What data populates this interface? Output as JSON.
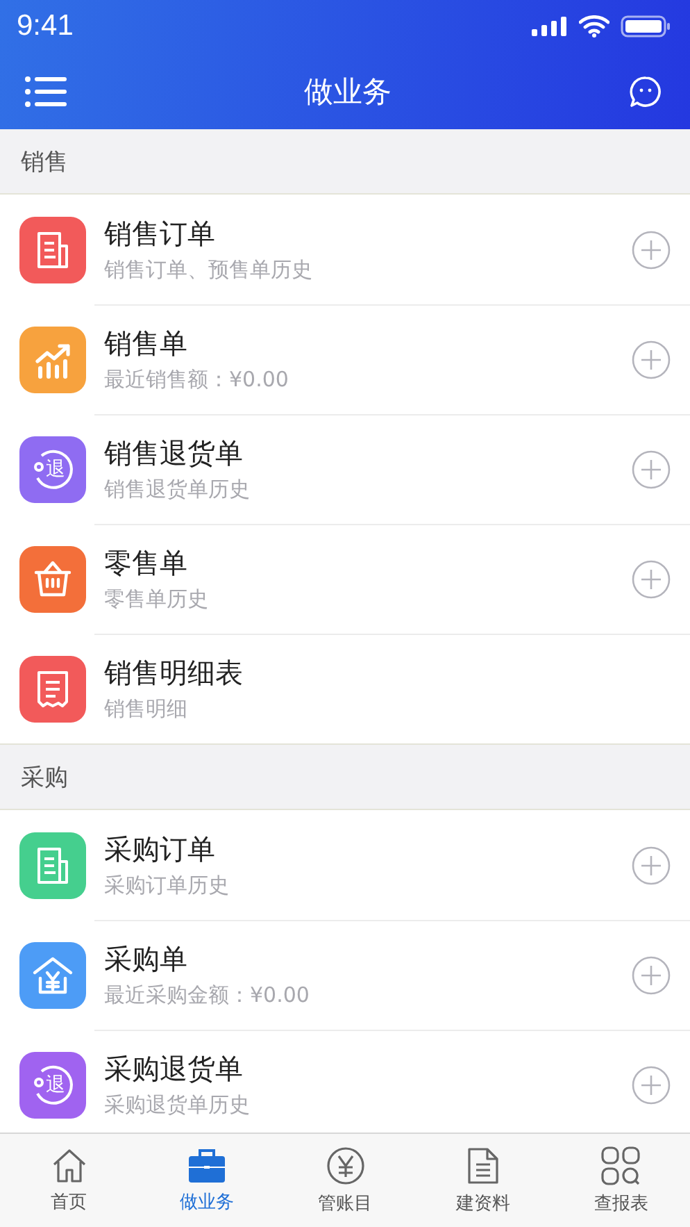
{
  "status_bar": {
    "time": "9:41"
  },
  "nav": {
    "title": "做业务"
  },
  "sections": [
    {
      "title": "销售",
      "items": [
        {
          "title": "销售订单",
          "subtitle": "销售订单、预售单历史",
          "kind": "document",
          "color": "#f25a5a",
          "addable": true
        },
        {
          "title": "销售单",
          "subtitle": "最近销售额：¥0.00",
          "kind": "chart",
          "color": "#f7a23e",
          "addable": true
        },
        {
          "title": "销售退货单",
          "subtitle": "销售退货单历史",
          "kind": "return",
          "icon_text": "退",
          "color": "#8f6cf2",
          "addable": true
        },
        {
          "title": "零售单",
          "subtitle": "零售单历史",
          "kind": "basket",
          "color": "#f36f3a",
          "addable": true
        },
        {
          "title": "销售明细表",
          "subtitle": "销售明细",
          "kind": "receipt",
          "color": "#f25a5a",
          "addable": false
        }
      ]
    },
    {
      "title": "采购",
      "items": [
        {
          "title": "采购订单",
          "subtitle": "采购订单历史",
          "kind": "document",
          "color": "#45cf8e",
          "addable": true
        },
        {
          "title": "采购单",
          "subtitle": "最近采购金额：¥0.00",
          "kind": "house",
          "color": "#4d9cf6",
          "addable": true
        },
        {
          "title": "采购退货单",
          "subtitle": "采购退货单历史",
          "kind": "return",
          "icon_text": "退",
          "color": "#a063f0",
          "addable": true
        }
      ]
    }
  ],
  "tabs": [
    {
      "label": "首页",
      "kind": "home",
      "selected": false
    },
    {
      "label": "做业务",
      "kind": "briefcase",
      "selected": true
    },
    {
      "label": "管账目",
      "kind": "yen",
      "selected": false
    },
    {
      "label": "建资料",
      "kind": "file",
      "selected": false
    },
    {
      "label": "查报表",
      "kind": "grid",
      "selected": false
    }
  ]
}
